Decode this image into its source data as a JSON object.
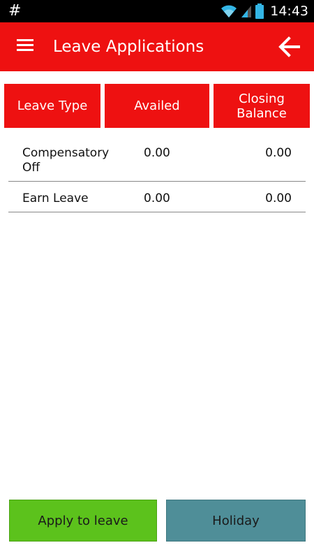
{
  "status_bar": {
    "notification_symbol": "#",
    "time": "14:43",
    "icons": [
      "wifi-icon",
      "signal-icon",
      "battery-icon"
    ]
  },
  "app_bar": {
    "title": "Leave Applications",
    "menu_icon": "menu-icon",
    "back_icon": "back-arrow-icon",
    "color": "#ee1111"
  },
  "table": {
    "headers": {
      "type": "Leave Type",
      "availed": "Availed",
      "closing": "Closing\nBalance"
    },
    "rows": [
      {
        "type": "Compensatory Off",
        "availed": "0.00",
        "closing": "0.00"
      },
      {
        "type": "Earn Leave",
        "availed": "0.00",
        "closing": "0.00"
      }
    ]
  },
  "actions": {
    "apply_label": "Apply to leave",
    "holiday_label": "Holiday",
    "apply_color": "#5cc21c",
    "holiday_color": "#4f8e98"
  }
}
